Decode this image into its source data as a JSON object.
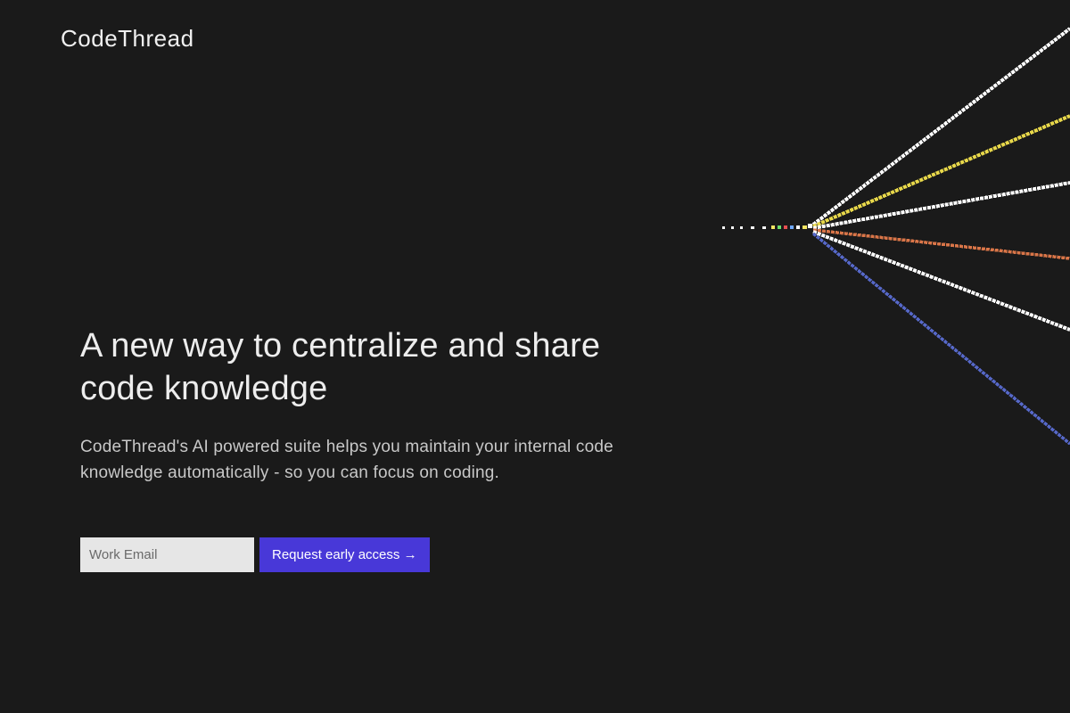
{
  "brand": {
    "name": "CodeThread"
  },
  "hero": {
    "title": "A new way to centralize and share code knowledge",
    "subtitle": "CodeThread's AI powered suite helps you maintain your internal code knowledge automatically - so you can focus on coding."
  },
  "form": {
    "email_placeholder": "Work Email",
    "cta_label": "Request early access →"
  },
  "colors": {
    "background": "#1a1a1a",
    "text_primary": "#ededed",
    "text_secondary": "#c8c8c8",
    "button_bg": "#4838d8",
    "input_bg": "#e6e6e6"
  }
}
